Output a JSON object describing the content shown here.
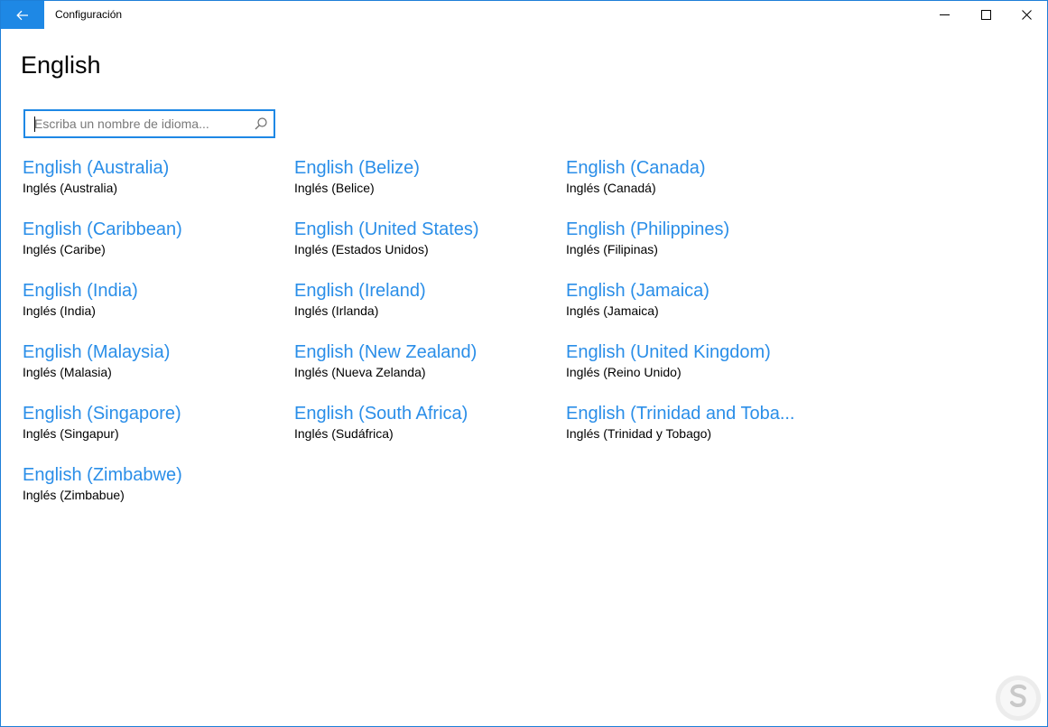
{
  "window": {
    "title": "Configuración"
  },
  "page": {
    "title": "English"
  },
  "search": {
    "placeholder": "Escriba un nombre de idioma..."
  },
  "languages": [
    {
      "name": "English (Australia)",
      "native": "Inglés (Australia)"
    },
    {
      "name": "English (Belize)",
      "native": "Inglés (Belice)"
    },
    {
      "name": "English (Canada)",
      "native": "Inglés (Canadá)"
    },
    {
      "name": "English (Caribbean)",
      "native": "Inglés (Caribe)"
    },
    {
      "name": "English (United States)",
      "native": "Inglés (Estados Unidos)"
    },
    {
      "name": "English (Philippines)",
      "native": "Inglés (Filipinas)"
    },
    {
      "name": "English (India)",
      "native": "Inglés (India)"
    },
    {
      "name": "English (Ireland)",
      "native": "Inglés (Irlanda)"
    },
    {
      "name": "English (Jamaica)",
      "native": "Inglés (Jamaica)"
    },
    {
      "name": "English (Malaysia)",
      "native": "Inglés (Malasia)"
    },
    {
      "name": "English (New Zealand)",
      "native": "Inglés (Nueva Zelanda)"
    },
    {
      "name": "English (United Kingdom)",
      "native": "Inglés (Reino Unido)"
    },
    {
      "name": "English (Singapore)",
      "native": "Inglés (Singapur)"
    },
    {
      "name": "English (South Africa)",
      "native": "Inglés (Sudáfrica)"
    },
    {
      "name": "English (Trinidad and Toba...",
      "native": "Inglés (Trinidad y Tobago)"
    },
    {
      "name": "English (Zimbabwe)",
      "native": "Inglés (Zimbabue)"
    }
  ],
  "colors": {
    "accent": "#1e88e5",
    "link": "#2a8ee8",
    "border": "#1e7fd8"
  },
  "icons": {
    "back": "arrow-left-icon",
    "minimize": "minimize-icon",
    "maximize": "maximize-icon",
    "close": "close-icon",
    "search": "search-icon",
    "watermark": "watermark-logo-icon"
  }
}
